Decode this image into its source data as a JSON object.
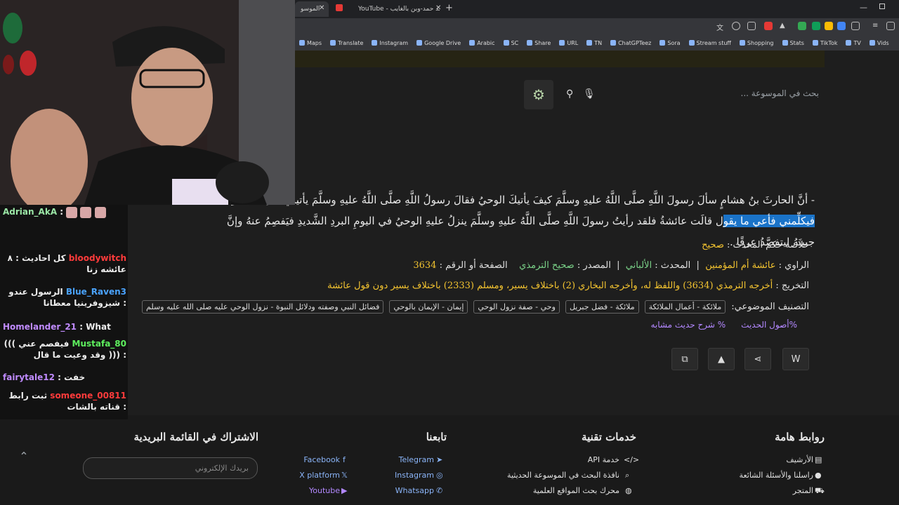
{
  "browser": {
    "tabs": [
      {
        "label": "الموسو",
        "active": true
      },
      {
        "label": "YouTube - محمد حمد-وبن بالغايب",
        "active": false
      }
    ],
    "new_tab": "+",
    "bookmarks": [
      "Maps",
      "Translate",
      "Instagram",
      "Google Drive",
      "Arabic",
      "SC",
      "Share",
      "URL",
      "TN",
      "ChatGPTeez",
      "Sora",
      "Stream stuff",
      "Shopping",
      "Stats",
      "TikTok",
      "TV",
      "Vids"
    ]
  },
  "header": {
    "search_placeholder": "بحث في الموسوعة ..."
  },
  "hadith": {
    "text_line1": "- أنَّ الحارثَ بنُ هشامٍ سألَ رسولَ اللَّهِ صلَّى اللَّهُ عليهِ وسلَّمَ كيفَ يأتيكَ الوحيُ فقالَ رسولُ اللَّهِ صلَّى اللَّهُ عليهِ وسلَّمَ يأتيني مثلَ صلصلةِ",
    "highlight": "فيكلِّمني فأعي ما يقو",
    "text_line2": "ل قالَت عائشةُ فلقد رأيتُ رسولَ اللَّهِ صلَّى اللَّهُ عليهِ وسلَّمَ ينزلُ عليهِ الوحيُ في اليومِ البردِ الشَّديدِ فيَفصِمُ عنهُ وإنَّ جبينَهُ ليتفصَّدُ عرقًا .",
    "summary_label": "خلاصة حكم المحدث :",
    "summary_value": "صحيح",
    "narrator_label": "الراوي :",
    "narrator_value": "عائشة أم المؤمنين",
    "muhaddith_label": "المحدث :",
    "muhaddith_value": "الألباني",
    "source_label": "المصدر :",
    "source_value": "صحيح الترمذي",
    "page_label": "الصفحة أو الرقم :",
    "page_value": "3634",
    "takhrij_label": "التخريج :",
    "takhrij_value": "أخرجه الترمذي (3634) واللفظ له، وأخرجه البخاري (2) باختلاف يسير، ومسلم (2333) باختلاف يسير دون قول عائشة",
    "classification_label": "التصنيف الموضوعي:",
    "tags": [
      "ملائكة - أعمال الملائكة",
      "ملائكة - فضل جبريل",
      "وحي - صفة نزول الوحي",
      "إيمان - الإيمان بالوحي",
      "فضائل النبي وصفته ودلائل النبوة - نزول الوحي عليه صلى الله عليه وسلم"
    ],
    "link_usul": "أصول الحديث",
    "link_sharh": "شرح حديث مشابه",
    "pct": "%"
  },
  "footer": {
    "col_links_title": "روابط هامة",
    "col_links": [
      "الأرشيف",
      "راسلنا والأسئلة الشائعة",
      "المتجر"
    ],
    "col_tech_title": "خدمات تقنية",
    "col_tech": [
      "خدمة API",
      "نافذة البحث في الموسوعة الحديثية",
      "محرك بحث المواقع العلمية"
    ],
    "col_follow_title": "تابعنا",
    "col_follow_a": [
      "Telegram",
      "Instagram",
      "Whatsapp"
    ],
    "col_follow_b": [
      "Facebook",
      "X platform",
      "Youtube"
    ],
    "col_sub_title": "الاشتراك في القائمة البريدية",
    "email_placeholder": "بريدك الإلكتروني"
  },
  "chat": [
    {
      "user": "Adrian_AkA",
      "color": "#9be7a6",
      "text": ""
    },
    {
      "user": "bloodywitch",
      "color": "#ff3b3b",
      "text": "كل احاديث : ٨ عائشه زنا"
    },
    {
      "user": "Blue_Raven3",
      "color": "#4aa3ff",
      "text": "الرسول عندو : شيزوفرينيا معطانا"
    },
    {
      "user": "Homelander_21",
      "color": "#c08bff",
      "text": "What"
    },
    {
      "user": "Mustafa_80",
      "color": "#5ef05e",
      "text": "فيفصم عني ))) : ((( وقد وعيت ما قال"
    },
    {
      "user": "fairytale12",
      "color": "#c08bff",
      "text": "خفت"
    },
    {
      "user": "someone_00811",
      "color": "#ff3b3b",
      "text": "ثبت رابط : قناته بالشات"
    }
  ]
}
